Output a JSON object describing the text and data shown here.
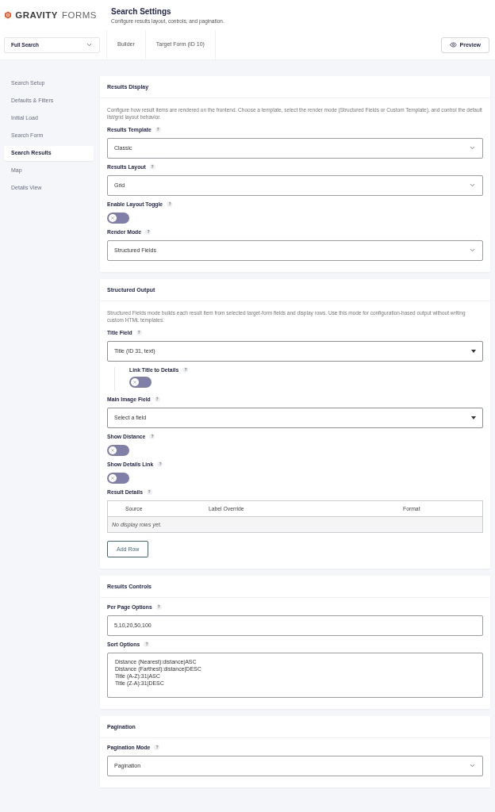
{
  "header": {
    "logo": {
      "strong": "GRAVITY",
      "light": "FORMS"
    },
    "title": "Search Settings",
    "subtitle": "Configure results layout, controls, and pagination."
  },
  "toolbar": {
    "form_select": "Full Search",
    "tabs": [
      {
        "label": "Builder",
        "selected": false
      },
      {
        "label": "Target Form (ID 10)",
        "selected": false
      }
    ],
    "preview": "Preview"
  },
  "sidebar": {
    "items": [
      {
        "label": "Search Setup",
        "selected": false
      },
      {
        "label": "Defaults & Filters",
        "selected": false
      },
      {
        "label": "Initial Load",
        "selected": false
      },
      {
        "label": "Search Form",
        "selected": false
      },
      {
        "label": "Search Results",
        "selected": true
      },
      {
        "label": "Map",
        "selected": false
      },
      {
        "label": "Details View",
        "selected": false
      }
    ]
  },
  "sections": [
    {
      "title": "Results Display",
      "description": "Configure how result items are rendered on the frontend. Choose a template, select the render mode (Structured Fields or Custom Template), and control the default list/grid layout behavior.",
      "fields": [
        {
          "kind": "select",
          "label": "Results Template",
          "value": "Classic"
        },
        {
          "kind": "select",
          "label": "Results Layout",
          "value": "Grid"
        },
        {
          "kind": "toggle",
          "label": "Enable Layout Toggle",
          "on": false
        },
        {
          "kind": "select",
          "label": "Render Mode",
          "value": "Structured Fields"
        }
      ]
    },
    {
      "title": "Structured Output",
      "description": "Structured Fields mode builds each result item from selected target-form fields and display rows. Use this mode for configuration-based output without writing custom HTML templates.",
      "fields": [
        {
          "kind": "dropdown",
          "label": "Title Field",
          "value": "Title (ID 31, text)"
        },
        {
          "kind": "nested-toggle",
          "label": "Link Title to Details",
          "on": false
        },
        {
          "kind": "dropdown",
          "label": "Main Image Field",
          "value": "Select a field"
        },
        {
          "kind": "toggle",
          "label": "Show Distance",
          "on": false
        },
        {
          "kind": "toggle",
          "label": "Show Details Link",
          "on": false
        },
        {
          "kind": "table",
          "label": "Result Details",
          "columns": [
            "Source",
            "Label Override",
            "Format"
          ],
          "empty": "No display rows yet.",
          "button": "Add Row"
        }
      ]
    },
    {
      "title": "Results Controls",
      "fields": [
        {
          "kind": "input",
          "label": "Per Page Options",
          "value": "5,10,20,50,100"
        },
        {
          "kind": "textarea",
          "label": "Sort Options",
          "lines": [
            "Distance (Nearest):distance|ASC",
            "Distance (Farthest):distance|DESC",
            "Title (A-Z):31|ASC",
            "Title (Z-A):31|DESC"
          ]
        }
      ]
    },
    {
      "title": "Pagination",
      "fields": [
        {
          "kind": "select",
          "label": "Pagination Mode",
          "value": "Pagination"
        }
      ]
    }
  ]
}
